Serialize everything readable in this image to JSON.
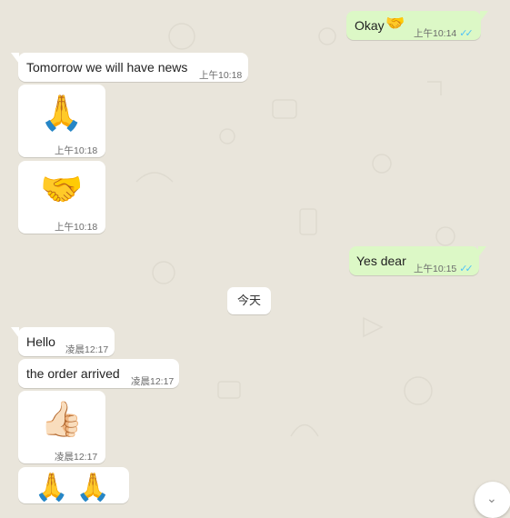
{
  "messages": {
    "m1": {
      "text": "Okay",
      "emoji": "🤝",
      "time": "上午10:14",
      "ticks": "✓✓"
    },
    "m2": {
      "text": "Tomorrow we will have news",
      "time": "上午10:18"
    },
    "m3": {
      "emoji": "🙏",
      "time": "上午10:18"
    },
    "m4": {
      "emoji": "🤝",
      "time": "上午10:18"
    },
    "m5": {
      "text": "Yes dear",
      "time": "上午10:15",
      "ticks": "✓✓"
    },
    "date_divider": "今天",
    "m6": {
      "text": "Hello",
      "time": "凌晨12:17"
    },
    "m7": {
      "text": "the order arrived",
      "time": "凌晨12:17"
    },
    "m8": {
      "emoji": "👍🏻",
      "time": "凌晨12:17"
    },
    "m9": {
      "emoji": "🙏 🙏"
    }
  },
  "colors": {
    "incoming": "#ffffff",
    "outgoing": "#dcf8c6",
    "read_ticks": "#4fc3f7",
    "background": "#e9e5db"
  },
  "icons": {
    "scroll_button": "chevron-down-icon"
  }
}
